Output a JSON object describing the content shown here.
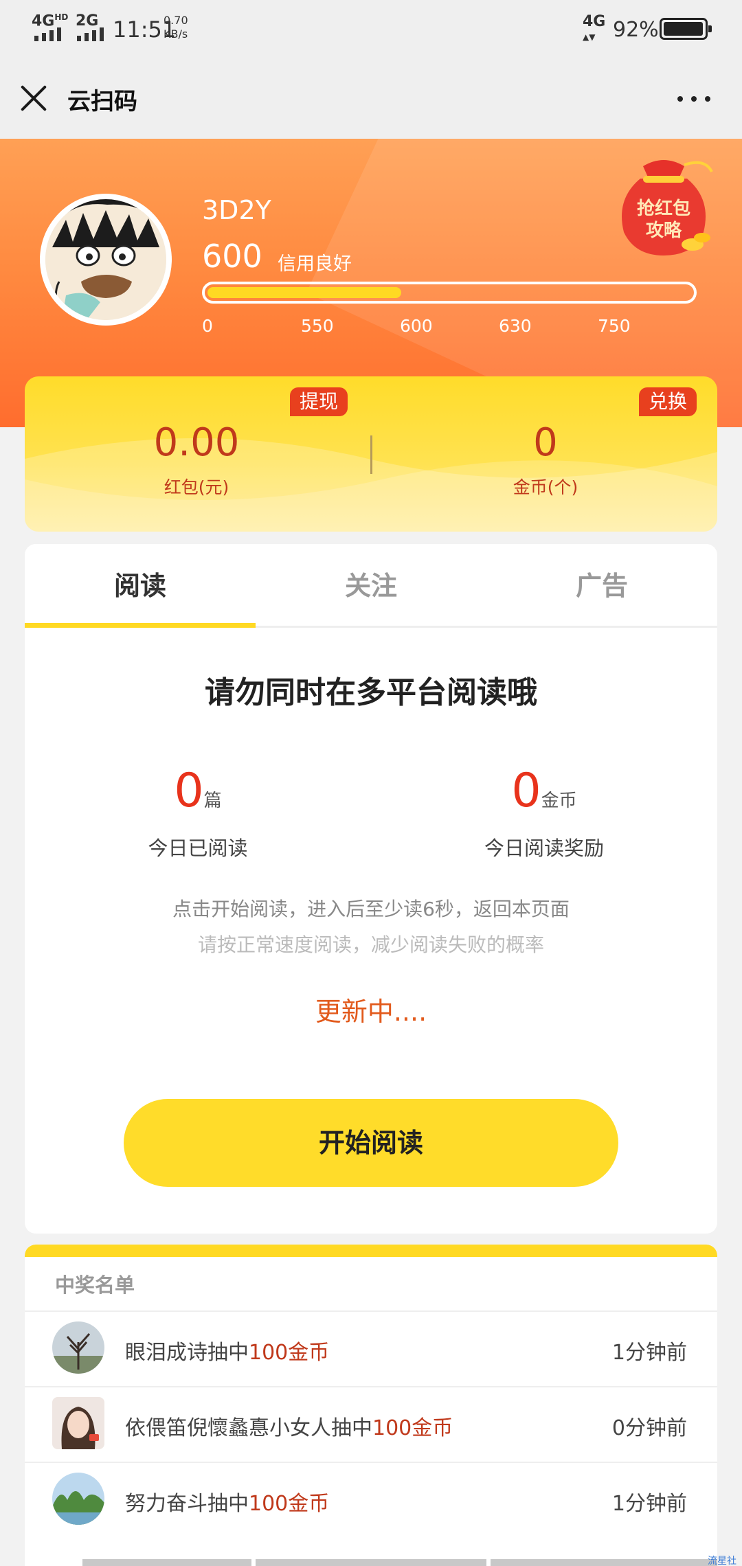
{
  "status_bar": {
    "network_1": "4G",
    "network_1_sup": "HD",
    "network_2": "2G",
    "time": "11:51",
    "speed_value": "0.70",
    "speed_unit": "KB/s",
    "network_3": "4G",
    "battery_percent": "92%",
    "battery_level": 0.92
  },
  "titlebar": {
    "title": "云扫码",
    "close_icon": "close-icon",
    "more_icon": "more-dots-icon"
  },
  "profile": {
    "username": "3D2Y",
    "score": "600",
    "credit_label": "信用良好",
    "progress_fraction": 0.4,
    "ticks": [
      "0",
      "550",
      "600",
      "630",
      "750"
    ],
    "redbag_text_line1": "抢红包",
    "redbag_text_line2": "攻略"
  },
  "wallet": {
    "withdraw_label": "提现",
    "exchange_label": "兑换",
    "redpacket_value": "0.00",
    "redpacket_label": "红包(元)",
    "coins_value": "0",
    "coins_label": "金币(个)"
  },
  "tabs": [
    "阅读",
    "关注",
    "广告"
  ],
  "active_tab": 0,
  "reading": {
    "notice": "请勿同时在多平台阅读哦",
    "read_count": "0",
    "read_unit": "篇",
    "read_label": "今日已阅读",
    "reward_count": "0",
    "reward_unit": "金币",
    "reward_label": "今日阅读奖励",
    "hint1": "点击开始阅读，进入后至少读6秒，返回本页面",
    "hint2": "请按正常速度阅读，减少阅读失败的概率",
    "updating": "更新中....",
    "start_button": "开始阅读"
  },
  "winners": {
    "title": "中奖名单",
    "rows": [
      {
        "name": "眼泪成诗抽中",
        "prize": "100金币",
        "time": "1分钟前"
      },
      {
        "name": "依偎笛倪懷蠡惪小女人抽中",
        "prize": "100金币",
        "time": "0分钟前"
      },
      {
        "name": "努力奋斗抽中",
        "prize": "100金币",
        "time": "1分钟前"
      }
    ]
  },
  "watermark": "流星社区",
  "colors": {
    "accent_yellow": "#ffd923",
    "accent_red": "#e8331c",
    "hero_orange": "#ff8a40"
  }
}
